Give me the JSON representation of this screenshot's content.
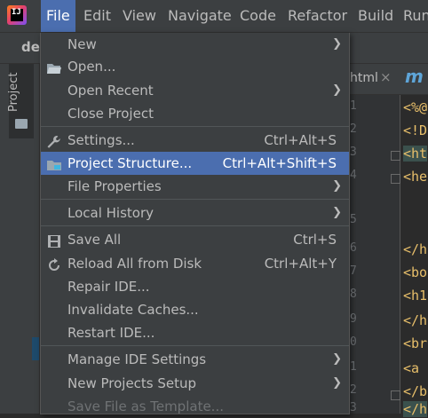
{
  "menubar": {
    "items": [
      {
        "label": "File"
      },
      {
        "label": "Edit"
      },
      {
        "label": "View"
      },
      {
        "label": "Navigate"
      },
      {
        "label": "Code"
      },
      {
        "label": "Refactor"
      },
      {
        "label": "Build"
      },
      {
        "label": "Run"
      }
    ]
  },
  "breadcrumb": "de",
  "tool_window": {
    "project_label": "Project"
  },
  "editor": {
    "tab_name": "html",
    "tab_close": "×",
    "tab_m": "m",
    "line_numbers": [
      "1",
      "2",
      "3",
      "4",
      "5",
      "6",
      "7",
      "8",
      "9",
      "0",
      "1",
      "2",
      "3"
    ],
    "code_lines": [
      "<%@",
      "<!D",
      "<ht",
      "<he",
      "",
      "</h",
      "<bo",
      "<h1",
      "</h",
      "<br",
      "<a ",
      "</b",
      "</h"
    ]
  },
  "file_menu": {
    "items": [
      {
        "label": "New",
        "shortcut": "",
        "submenu": true,
        "icon": ""
      },
      {
        "label": "Open...",
        "shortcut": "",
        "submenu": false,
        "icon": "folder-open-icon"
      },
      {
        "label": "Open Recent",
        "shortcut": "",
        "submenu": true,
        "icon": ""
      },
      {
        "label": "Close Project",
        "shortcut": "",
        "submenu": false,
        "icon": ""
      },
      {
        "label": "Settings...",
        "shortcut": "Ctrl+Alt+S",
        "submenu": false,
        "icon": "wrench-icon"
      },
      {
        "label": "Project Structure...",
        "shortcut": "Ctrl+Alt+Shift+S",
        "submenu": false,
        "icon": "project-structure-icon",
        "selected": true
      },
      {
        "label": "File Properties",
        "shortcut": "",
        "submenu": true,
        "icon": ""
      },
      {
        "label": "Local History",
        "shortcut": "",
        "submenu": true,
        "icon": ""
      },
      {
        "label": "Save All",
        "shortcut": "Ctrl+S",
        "submenu": false,
        "icon": "save-icon"
      },
      {
        "label": "Reload All from Disk",
        "shortcut": "Ctrl+Alt+Y",
        "submenu": false,
        "icon": "reload-icon"
      },
      {
        "label": "Repair IDE...",
        "shortcut": "",
        "submenu": false,
        "icon": ""
      },
      {
        "label": "Invalidate Caches...",
        "shortcut": "",
        "submenu": false,
        "icon": ""
      },
      {
        "label": "Restart IDE...",
        "shortcut": "",
        "submenu": false,
        "icon": ""
      },
      {
        "label": "Manage IDE Settings",
        "shortcut": "",
        "submenu": true,
        "icon": ""
      },
      {
        "label": "New Projects Setup",
        "shortcut": "",
        "submenu": true,
        "icon": ""
      },
      {
        "label": "Save File as Template...",
        "shortcut": "",
        "submenu": false,
        "icon": "",
        "disabled": true
      }
    ],
    "submenu_arrow": "❯"
  },
  "colors": {
    "menubar_bg": "#3c3f41",
    "selection": "#4b6eaf",
    "editor_bg": "#2b2b2b",
    "tag_color": "#e8bf6a"
  }
}
